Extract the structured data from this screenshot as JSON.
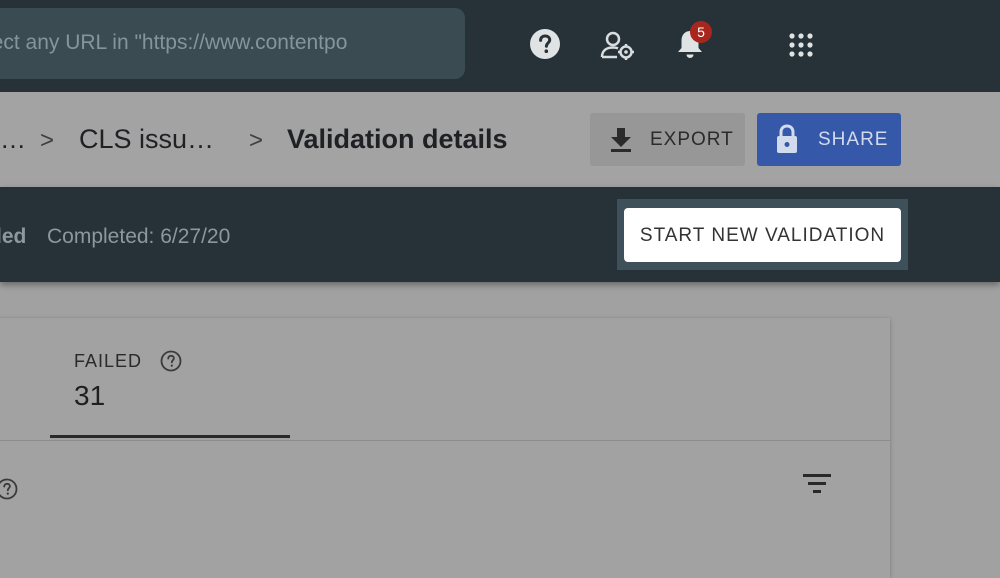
{
  "topbar": {
    "search_text": "pect any URL in \"https://www.contentpo",
    "notification_count": "5",
    "icons": [
      "help-icon",
      "manage-users-icon",
      "notifications-icon",
      "apps-grid-icon"
    ]
  },
  "breadcrumb": {
    "ellipsis": "…",
    "separator": ">",
    "parent": "CLS issu…",
    "current": "Validation details"
  },
  "actions": {
    "export_label": "EXPORT",
    "share_label": "SHARE"
  },
  "status": {
    "state_fragment": "led",
    "completed": "Completed: 6/27/20",
    "start_label": "START NEW VALIDATION"
  },
  "card": {
    "tab_label": "FAILED",
    "tab_value": "31"
  },
  "colors": {
    "topbar": "#263238",
    "share_button": "#3558a8",
    "badge": "#a8261d"
  }
}
